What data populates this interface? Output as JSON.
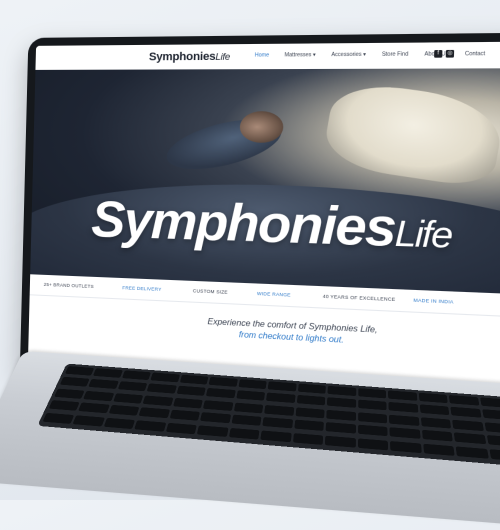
{
  "site": {
    "logo_main": "Symphonies",
    "logo_sub": "Life",
    "nav": [
      {
        "label": "Home",
        "active": true
      },
      {
        "label": "Mattresses ▾",
        "active": false
      },
      {
        "label": "Accessories ▾",
        "active": false
      },
      {
        "label": "Store Find",
        "active": false
      },
      {
        "label": "About Us",
        "active": false
      },
      {
        "label": "Contact",
        "active": false
      }
    ],
    "header_icons": [
      "f",
      "◎"
    ]
  },
  "hero": {
    "logo_main": "Symphonies",
    "logo_sub": "Life"
  },
  "features": [
    {
      "label": "25+ BRAND OUTLETS",
      "color": "#3a4150"
    },
    {
      "label": "FREE DELIVERY",
      "color": "#2f7ac9"
    },
    {
      "label": "CUSTOM SIZE",
      "color": "#3a4150"
    },
    {
      "label": "WIDE RANGE",
      "color": "#2f7ac9"
    },
    {
      "label": "40 YEARS OF EXCELLENCE",
      "color": "#3a4150"
    },
    {
      "label": "MADE IN INDIA",
      "color": "#2f7ac9"
    }
  ],
  "tagline": {
    "line1": "Experience the comfort of Symphonies Life,",
    "line2": "from checkout to lights out."
  },
  "colors": {
    "accent": "#2f7ac9",
    "text": "#3a4150"
  }
}
